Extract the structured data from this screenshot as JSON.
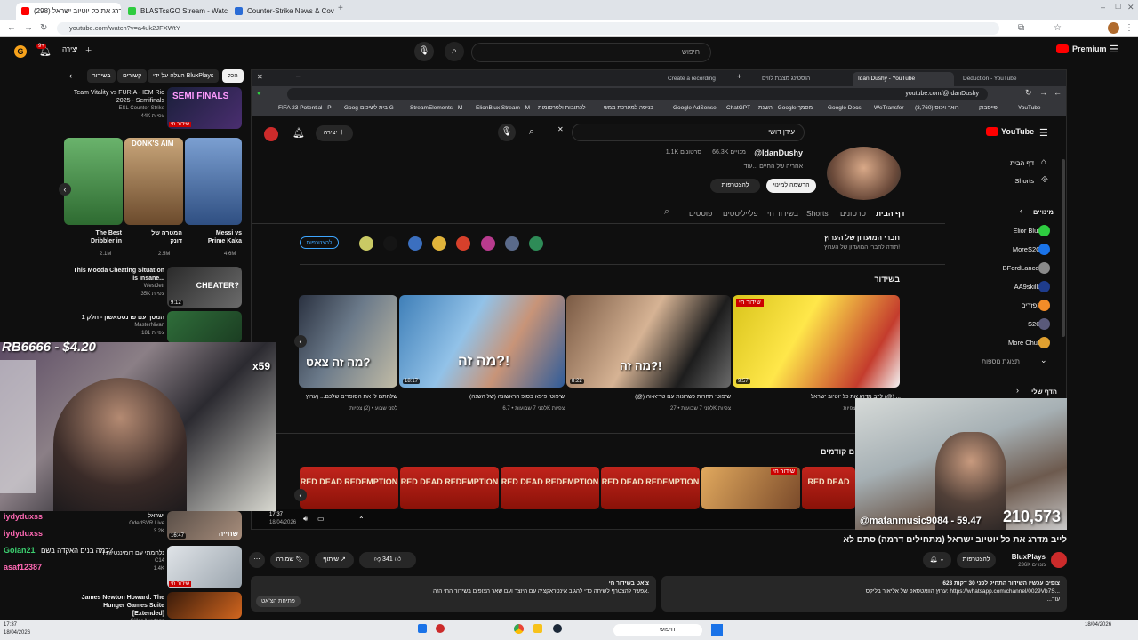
{
  "outer_browser": {
    "tabs": [
      {
        "label": "(298) לייב מדרג את כל יוטיוב ישראל",
        "color": "#ff0000",
        "active": true
      },
      {
        "label": "BLASTcsGO Stream - Watch Live",
        "color": "#2ecc40",
        "active": false
      },
      {
        "label": "Counter-Strike News & Coverage",
        "color": "#2a6cd6",
        "active": false
      }
    ],
    "url": "youtube.com/watch?v=a4uk2JFXWtY"
  },
  "header": {
    "create_label": "יצירה",
    "search_placeholder": "חיפוש",
    "premium_label": "Premium",
    "notif_count": "9+"
  },
  "left_panel": {
    "chips": [
      "הכל",
      "העלה על ידי BluxPlays",
      "קשורים",
      "בשידור"
    ],
    "top_video": {
      "title": "Team Vitality vs FURIA - IEM Rio 2025 - Semifinals",
      "channel": "ESL Counter-Strike",
      "views": "44K צפיות",
      "thumb_text": "SEMI FINALS",
      "live": "שידור חי"
    },
    "shorts": [
      {
        "title": "The Best Dribbler in",
        "views": "2.1M",
        "color": "#3a7f3d"
      },
      {
        "title": "המטרה של דונק",
        "views": "2.5M",
        "color": "#a77b4f",
        "thumb_text": "DONK'S AIM"
      },
      {
        "title": "Messi vs Prime Kaka",
        "views": "4.6M",
        "color": "#3d5ba9"
      }
    ],
    "videos": [
      {
        "title": "This Mooda Cheating Situation is Insane...",
        "channel": "WestJett",
        "views": "35K צפיות",
        "thumb_text": "CHEATER?",
        "duration": "9:12"
      },
      {
        "title": "המטך עם פרנסטאשון - חלק 1",
        "channel": "MasterNivan",
        "views": "181 צפיות"
      },
      {
        "title": "ישראל",
        "channel": "OdedSVR Live",
        "views": "3.2K",
        "duration": "16:47",
        "thumb_text": "שחייה"
      },
      {
        "title": "I נלחמתי עם דומיננטיות",
        "channel": "C14",
        "views": "1.4K",
        "live": "שידור חי"
      },
      {
        "title": "James Newton Howard: The Hunger Games Suite [Extended]",
        "channel": "Gilles Nuytens"
      }
    ]
  },
  "overlay_text": {
    "donation": "RB6666 - $4.20",
    "counter_small": "x59",
    "viewer_handle": "@matanmusic9084 - 59.47",
    "viewer_count": "210,573"
  },
  "inner_browser": {
    "tabs": [
      {
        "label": "Deduction - YouTube",
        "active": false
      },
      {
        "label": "Idan Dushy - YouTube",
        "active": true
      },
      {
        "label": "הוסטינג מצבת לווים",
        "active": false
      },
      {
        "label": "Create a recording",
        "active": false
      }
    ],
    "url": "youtube.com/@IdanDushy",
    "bookmarks": [
      "YouTube",
      "פייסבוק",
      "(3,760) רואר ויכוס",
      "WeTransfer",
      "Google Docs",
      "השנת - Google מסמך",
      "ChatGPT",
      "Google AdSense",
      "כניסה למערכת ממש",
      "לכתובות ולפרסומות",
      "ElionBlux Stream - M",
      "StreamElements - M",
      "בית לשיכום G",
      "Goog",
      "FIFA 23 Potential - P"
    ]
  },
  "channel": {
    "search_query": "עידן דושי",
    "name": "עידן דושי",
    "handle": "@IdanDushy",
    "subs": "66.3K מנויים",
    "video_count": "1.1K סרטונים",
    "about": "אחריה של החיים ...עוד",
    "join_label": "הרשמה למינוי",
    "subscribe_label": "להצטרפות",
    "tabs": [
      "דף הבית",
      "סרטונים",
      "Shorts",
      "בשידור חי",
      "פלייליסטים",
      "פוסטים"
    ],
    "members_title": "חברי המועדון של הערוץ",
    "members_sub": "תודה לחברי המועדון של הערוץ!",
    "members_join": "להצטרפות",
    "section_live": "בשידור",
    "section_prev": "ם קודמים",
    "videos": [
      {
        "caption": "שלחתם לי את הסופרים שלכם... (ערוץ",
        "meta": "לפני שבוע • (2) צפיות",
        "thumb_text": "מה זה צאט?",
        "duration": ""
      },
      {
        "caption": "שיפוטי פיפא בסופ הראשונה (של השנה)",
        "meta": "לפני 7 שבועות • 6.7K צפיות",
        "thumb_text": "מה זה?!",
        "duration": "18:17"
      },
      {
        "caption": "(@) שיפוטי תחרות כשרונות עם טריא-וה",
        "meta": "לפני 7 שבועות • 27K צפיות",
        "thumb_text": "מה זה?!",
        "duration": "8:22"
      },
      {
        "caption": "לייב מדרג את כל יוטיוב ישראל (@) ...",
        "meta": "לפני 7 שבועות • (2) צפיות",
        "thumb_text": "שידור חי",
        "duration": "9:57"
      }
    ],
    "previous_thumbs": [
      "RED DEAD REDEMPTION",
      "RED DEAD REDEMPTION",
      "RED DEAD REDEMPTION",
      "RED DEAD REDEMPTION",
      "שידור חי",
      "RED DEAD"
    ]
  },
  "inner_sidebar": {
    "home": "דף הבית",
    "shorts": "Shorts",
    "subs_header": "מינויים",
    "subs": [
      {
        "name": "Elior Blux",
        "color": "#2ecc40"
      },
      {
        "name": "MoreS2G",
        "color": "#1a73e8"
      },
      {
        "name": "BFordLancer",
        "color": "#8a8a8a"
      },
      {
        "name": "AA9skillz",
        "color": "#1e3c8c"
      },
      {
        "name": "הפזרים",
        "color": "#f28c28"
      },
      {
        "name": "S2G",
        "color": "#5a5a7a"
      },
      {
        "name": "More Chuff",
        "color": "#e0a030"
      }
    ],
    "more": "תצוגת נוספות",
    "you": "הדף שלי"
  },
  "video_page": {
    "title": "לייב מדרג את כל יוטיוב ישראל (מתחילים דרמה) סתם לא",
    "channel_name": "BluxPlays",
    "channel_subs": "236K מנויים",
    "subscribe_label": "להצטרפות",
    "likes": "341",
    "share_label": "שיתוף",
    "save_label": "שמירה",
    "description_line1": "623 צופים עכשיו  השידור התחיל לפני 30 דקות",
    "description_line2": "ערוץ הוואטסאפ של אליאור בליקס: https://whatsapp.com/channel/0029Vb7S...",
    "description_more": "...עוד",
    "chat_line1": "צ'אט בשידור חי",
    "chat_line2": "אפשר להצטרף לשיחה כדי להגיב אינטראקציה עם היוצר ועם שאר הצופים בשידור החי הזה.",
    "chat_button": "פתיחת הצ'אט",
    "player_time": "17:37",
    "player_date": "18/04/2026"
  },
  "chat_names": [
    {
      "name": "iydyduxss",
      "color": "#ff69b4"
    },
    {
      "name": "iydyduxss",
      "color": "#ff69b4"
    },
    {
      "name": "Golan21",
      "color": "#3cd070"
    },
    {
      "name": "asaf12387",
      "color": "#ff69b4"
    }
  ],
  "chat_line": "כמה בנים האקדה בשם?",
  "taskbar": {
    "search": "חיפוש",
    "clock": "17:37",
    "date": "18/04/2026"
  }
}
